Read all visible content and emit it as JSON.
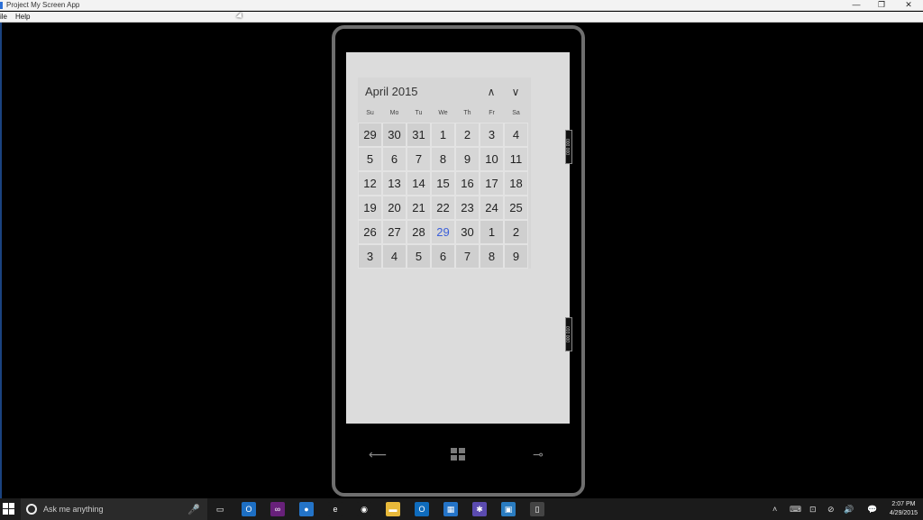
{
  "window": {
    "title": "Project My Screen App",
    "minimize": "—",
    "restore": "❐",
    "close": "✕"
  },
  "menu": {
    "file": "ile",
    "help": "Help"
  },
  "calendar": {
    "month_label": "April 2015",
    "prev_icon": "∧",
    "next_icon": "∨",
    "weekdays": [
      "Su",
      "Mo",
      "Tu",
      "We",
      "Th",
      "Fr",
      "Sa"
    ],
    "weeks": [
      [
        "29",
        "30",
        "31",
        "1",
        "2",
        "3",
        "4"
      ],
      [
        "5",
        "6",
        "7",
        "8",
        "9",
        "10",
        "11"
      ],
      [
        "12",
        "13",
        "14",
        "15",
        "16",
        "17",
        "18"
      ],
      [
        "19",
        "20",
        "21",
        "22",
        "23",
        "24",
        "25"
      ],
      [
        "26",
        "27",
        "28",
        "29",
        "30",
        "1",
        "2"
      ],
      [
        "3",
        "4",
        "5",
        "6",
        "7",
        "8",
        "9"
      ]
    ],
    "today_color": "#3b5fd9"
  },
  "side_markers": [
    "000 000",
    "000 010"
  ],
  "phone_buttons": {
    "back": "⟵",
    "search": "⊸"
  },
  "taskbar": {
    "search_placeholder": "Ask me anything",
    "mic_icon": "🎤",
    "icons": [
      {
        "name": "task-view-icon",
        "glyph": "▭",
        "color": "#1b1b1b"
      },
      {
        "name": "outlook-icon",
        "glyph": "O",
        "color": "#1d6fc4"
      },
      {
        "name": "visual-studio-icon",
        "glyph": "∞",
        "color": "#68217a"
      },
      {
        "name": "app-icon-blue",
        "glyph": "●",
        "color": "#2474c8"
      },
      {
        "name": "edge-icon",
        "glyph": "e",
        "color": "#1b1b1b"
      },
      {
        "name": "chrome-icon",
        "glyph": "◉",
        "color": "#1b1b1b"
      },
      {
        "name": "file-explorer-icon",
        "glyph": "▬",
        "color": "#e8b93a"
      },
      {
        "name": "outlook-mail-icon",
        "glyph": "O",
        "color": "#0f6cbd"
      },
      {
        "name": "store-icon",
        "glyph": "▦",
        "color": "#2474c8"
      },
      {
        "name": "settings-app-icon",
        "glyph": "✱",
        "color": "#5b4bb0"
      },
      {
        "name": "photos-icon",
        "glyph": "▣",
        "color": "#2a7cc0"
      },
      {
        "name": "phone-app-icon",
        "glyph": "▯",
        "color": "#444"
      }
    ],
    "tray": [
      "˄",
      "⌨",
      "⊡",
      "⊘",
      "🔊",
      "▤",
      "💬",
      "⌨"
    ],
    "time": "2:07 PM",
    "date": "4/29/2015"
  }
}
